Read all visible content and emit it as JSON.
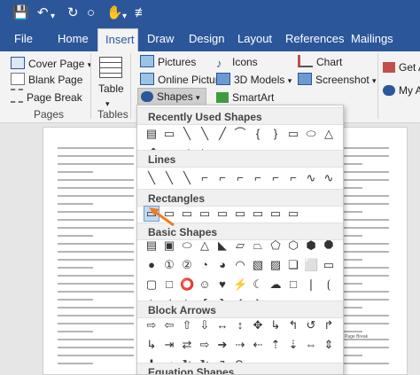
{
  "tabs": [
    {
      "label": "File",
      "active": false
    },
    {
      "label": "Home",
      "active": false
    },
    {
      "label": "Insert",
      "active": true
    },
    {
      "label": "Draw",
      "active": false
    },
    {
      "label": "Design",
      "active": false
    },
    {
      "label": "Layout",
      "active": false
    },
    {
      "label": "References",
      "active": false
    },
    {
      "label": "Mailings",
      "active": false
    }
  ],
  "ribbon": {
    "pages": {
      "cover_page": "Cover Page",
      "blank_page": "Blank Page",
      "page_break": "Page Break",
      "group_label": "Pages"
    },
    "tables": {
      "table": "Table",
      "group_label": "Tables"
    },
    "illustrations": {
      "pictures": "Pictures",
      "online_pictures": "Online Pictures",
      "shapes": "Shapes",
      "icons": "Icons",
      "models_3d": "3D Models",
      "smartart": "SmartArt",
      "chart": "Chart",
      "screenshot": "Screenshot"
    },
    "addins": {
      "get_addins": "Get A",
      "my_addins": "My A"
    }
  },
  "shapes_menu": {
    "sections": [
      "Recently Used Shapes",
      "Lines",
      "Rectangles",
      "Basic Shapes",
      "Block Arrows",
      "Equation Shapes"
    ],
    "recent_glyphs": [
      "▤",
      "▭",
      "╲",
      "╲",
      "╱",
      "⌒",
      "{",
      "}",
      "▭",
      "⬭",
      "△",
      "⬏",
      "⬎",
      "⇨",
      "⇦"
    ],
    "line_glyphs": [
      "╲",
      "╲",
      "╲",
      "⌐",
      "⌐",
      "⌐",
      "⌐",
      "⌐",
      "⌐",
      "∿",
      "∿",
      "⌒"
    ],
    "rect_glyphs": [
      "▭",
      "▭",
      "▭",
      "▭",
      "▭",
      "▭",
      "▭",
      "▭",
      "▭"
    ],
    "basic_glyphs": [
      "▤",
      "▣",
      "⬭",
      "△",
      "◣",
      "▱",
      "⏢",
      "⬠",
      "⬡",
      "⬢",
      "⯃",
      "●",
      "①",
      "②",
      "◔",
      "◕",
      "◠",
      "▧",
      "▨",
      "❏",
      "⬜",
      "▭",
      "▢",
      "□",
      "⭕",
      "☺",
      "♥",
      "⚡",
      "☾",
      "☁",
      "□",
      "❘",
      "⟮",
      "⟯",
      "⟬",
      "⟭",
      "❴",
      "❵",
      "{",
      "}"
    ],
    "arrow_glyphs": [
      "⇨",
      "⇦",
      "⇧",
      "⇩",
      "↔",
      "↕",
      "✥",
      "↳",
      "↰",
      "↺",
      "↱",
      "↳",
      "⇥",
      "⇄",
      "⇨",
      "➔",
      "⇢",
      "⇠",
      "⇡",
      "⇣",
      "⇔",
      "⇕",
      "✚",
      "➦",
      "↻",
      "↻",
      "↴",
      "↷"
    ]
  },
  "document": {
    "heading_label": "Page Break"
  }
}
